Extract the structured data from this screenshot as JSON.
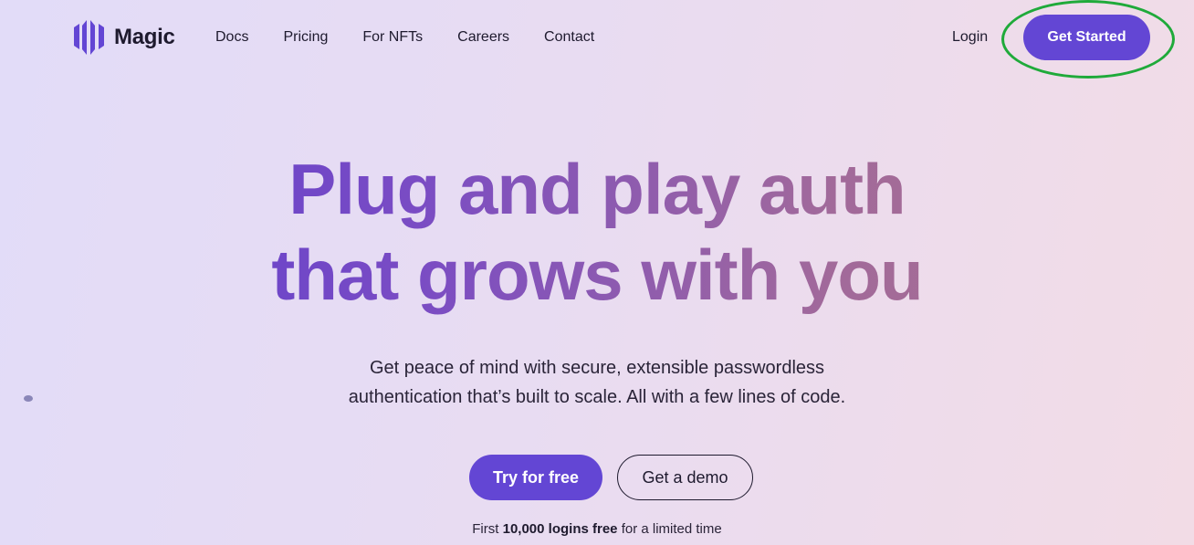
{
  "header": {
    "brand": "Magic",
    "logo_icon": "magic-logo-icon",
    "nav": [
      {
        "label": "Docs"
      },
      {
        "label": "Pricing"
      },
      {
        "label": "For NFTs"
      },
      {
        "label": "Careers"
      },
      {
        "label": "Contact"
      }
    ],
    "login_label": "Login",
    "get_started_label": "Get Started"
  },
  "hero": {
    "title_line1": "Plug and play auth",
    "title_line2": "that grows with you",
    "subtitle_line1": "Get peace of mind with secure, extensible passwordless",
    "subtitle_line2": "authentication that’s built to scale. All with a few lines of code.",
    "primary_cta": "Try for free",
    "secondary_cta": "Get a demo",
    "footnote_prefix": "First",
    "footnote_bold": "10,000 logins free",
    "footnote_suffix": "for a limited time"
  },
  "colors": {
    "accent": "#6346d4",
    "highlight_ring": "#1faa3a",
    "title_start": "#5a3ccf",
    "title_end": "#a8708e"
  }
}
